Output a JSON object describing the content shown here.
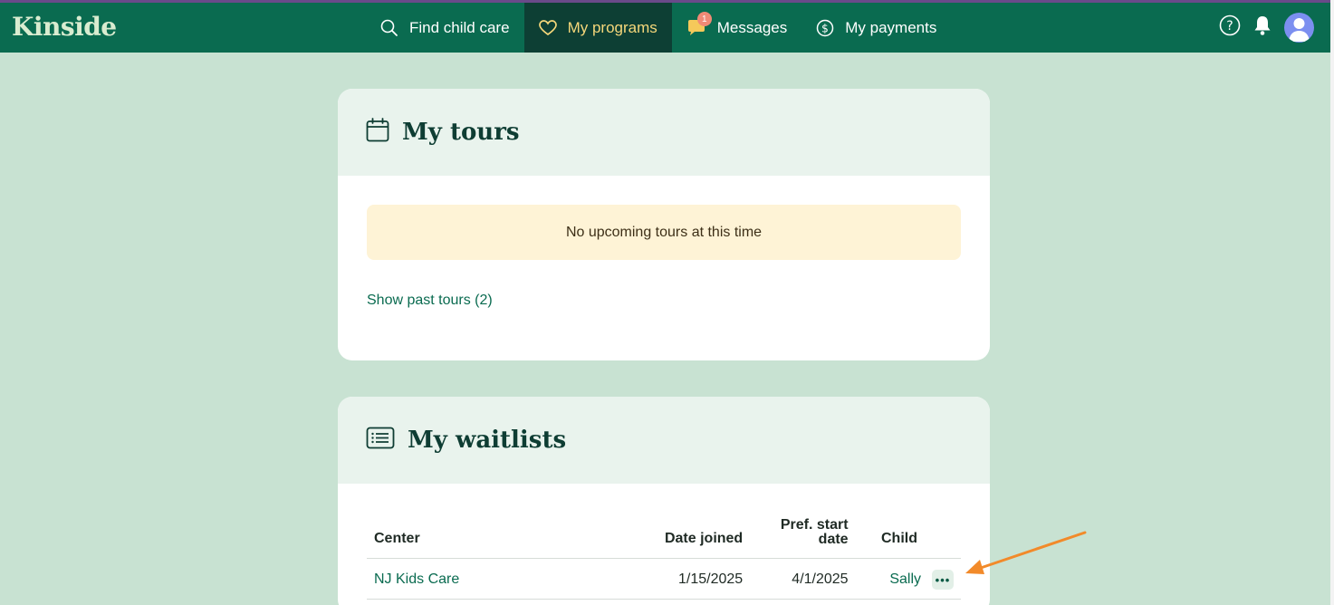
{
  "app": {
    "logo": "Kinside"
  },
  "nav": {
    "items": [
      {
        "label": "Find child care",
        "icon": "search-icon"
      },
      {
        "label": "My programs",
        "icon": "heart-icon",
        "active": true
      },
      {
        "label": "Messages",
        "icon": "chat-icon",
        "badge": "1"
      },
      {
        "label": "My payments",
        "icon": "dollar-icon"
      }
    ]
  },
  "top_icons": [
    "help-icon",
    "bell-icon",
    "avatar"
  ],
  "tours": {
    "title": "My tours",
    "icon": "calendar-icon",
    "notice": "No upcoming tours at this time",
    "past_link": "Show past tours (2)"
  },
  "waitlists": {
    "title": "My waitlists",
    "icon": "list-icon",
    "columns": [
      "Center",
      "Date joined",
      "Pref. start date",
      "Child"
    ],
    "rows": [
      {
        "center": "NJ Kids Care",
        "date_joined": "1/15/2025",
        "pref_start": "4/1/2025",
        "child": "Sally",
        "more": "•••"
      }
    ]
  },
  "colors": {
    "brand": "#0a6b50",
    "active_nav": "#0d3f34",
    "page_bg": "#c8e2d2",
    "notice_bg": "#fef3d6",
    "annotation_arrow": "#f28a2a"
  }
}
